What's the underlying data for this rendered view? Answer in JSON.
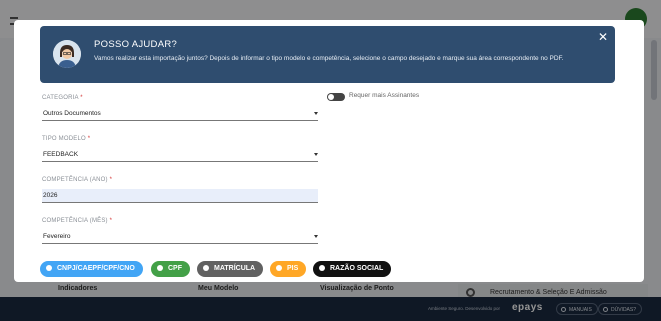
{
  "background": {
    "cards": [
      "Indicadores",
      "Meu Modelo",
      "Visualização de Ponto"
    ],
    "side_item": "Recrutamento & Seleção E Admissão",
    "footer": {
      "secure_text": "Ambiente Seguro. Desenvolvido por",
      "brand": "epays",
      "manuals_label": "MANUAIS",
      "doubts_label": "DÚVIDAS?"
    }
  },
  "modal": {
    "help": {
      "title": "POSSO AJUDAR?",
      "text": "Vamos realizar esta importação juntos? Depois de informar o tipo modelo e competência, selecione o campo desejado e marque sua área correspondente no PDF.",
      "close_icon": "close-icon"
    },
    "toggle_label": "Requer mais Assinantes",
    "fields": {
      "categoria": {
        "label": "CATEGORIA",
        "value": "Outros Documentos"
      },
      "tipo_modelo": {
        "label": "TIPO MODELO",
        "value": "FEEDBACK"
      },
      "competencia_ano": {
        "label": "COMPETÊNCIA (ANO)",
        "value": "2026"
      },
      "competencia_mes": {
        "label": "COMPETÊNCIA (MÊS)",
        "value": "Fevereiro"
      }
    },
    "required_mark": "*",
    "chips": [
      {
        "label": "CNPJ/CAEPF/CPF/CNO",
        "color": "#42a5f5"
      },
      {
        "label": "CPF",
        "color": "#43a047"
      },
      {
        "label": "MATRÍCULA",
        "color": "#616161"
      },
      {
        "label": "PIS",
        "color": "#ffa726"
      },
      {
        "label": "RAZÃO SOCIAL",
        "color": "#111111"
      }
    ]
  }
}
